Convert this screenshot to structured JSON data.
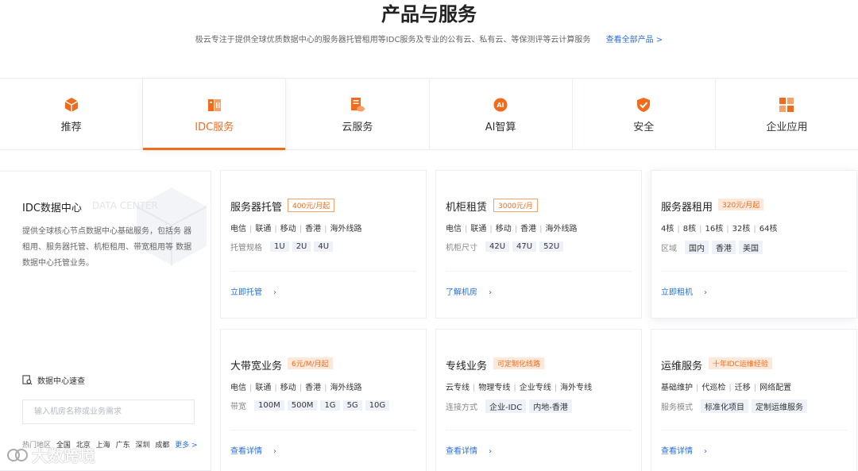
{
  "hero": {
    "title": "产品与服务",
    "subtitle": "极云专注于提供全球优质数据中心的服务器托管租用等IDC服务及专业的公有云、私有云、等保测评等云计算服务",
    "all_link": "查看全部产品 >"
  },
  "tabs": [
    {
      "label": "推荐",
      "icon": "cube-icon",
      "active": false
    },
    {
      "label": "IDC服务",
      "icon": "server-rack-icon",
      "active": true
    },
    {
      "label": "云服务",
      "icon": "cloud-doc-icon",
      "active": false
    },
    {
      "label": "AI智算",
      "icon": "ai-icon",
      "active": false
    },
    {
      "label": "安全",
      "icon": "shield-icon",
      "active": false
    },
    {
      "label": "企业应用",
      "icon": "grid-icon",
      "active": false
    }
  ],
  "left_panel": {
    "title": "IDC数据中心",
    "title_en": "DATA CENTER",
    "description": "提供全球核心节点数据中心基础服务，包括务 器租用、服务器托管、机柜租用、带宽租用等 数据数据中心托管业务。",
    "speed_title": "数据中心速查",
    "search_placeholder": "输入机房名称或业务需求",
    "hot_label": "热门地区",
    "hot_cities": [
      "全国",
      "北京",
      "上海",
      "广东",
      "深圳",
      "成都"
    ],
    "more": "更多 >"
  },
  "cards": [
    {
      "title": "服务器托管",
      "badge": "400元/月起",
      "badge_style": "outline",
      "lines": [
        "电信",
        "联通",
        "移动",
        "香港",
        "海外线路"
      ],
      "spec_label": "托管规格",
      "chips": [
        "1U",
        "2U",
        "4U"
      ],
      "action": "立即托管"
    },
    {
      "title": "机柜租赁",
      "badge": "3000元/月",
      "badge_style": "outline",
      "lines": [
        "电信",
        "联通",
        "移动",
        "香港",
        "海外线路"
      ],
      "spec_label": "机柜尺寸",
      "chips": [
        "42U",
        "47U",
        "52U"
      ],
      "action": "了解机房"
    },
    {
      "title": "服务器租用",
      "badge": "320元/月起",
      "badge_style": "filled",
      "lines": [
        "4核",
        "8核",
        "16核",
        "32核",
        "64核"
      ],
      "spec_label": "区域",
      "chips": [
        "国内",
        "香港",
        "美国"
      ],
      "action": "立即租机"
    },
    {
      "title": "大带宽业务",
      "badge": "6元/M/月起",
      "badge_style": "filled",
      "lines": [
        "电信",
        "联通",
        "移动",
        "香港",
        "海外线路"
      ],
      "spec_label": "带宽",
      "chips": [
        "100M",
        "500M",
        "1G",
        "5G",
        "10G"
      ],
      "action": "查看详情"
    },
    {
      "title": "专线业务",
      "badge": "可定制化线路",
      "badge_style": "filled",
      "lines": [
        "云专线",
        "物理专线",
        "企业专线",
        "海外专线"
      ],
      "spec_label": "连接方式",
      "chips": [
        "企业-IDC",
        "内地-香港"
      ],
      "action": "查看详情"
    },
    {
      "title": "运维服务",
      "badge": "十年IDC运维经验",
      "badge_style": "filled",
      "lines": [
        "基础维护",
        "代巡检",
        "迁移",
        "网络配置"
      ],
      "spec_label": "服务模式",
      "chips": [
        "标准化项目",
        "定制运维服务"
      ],
      "action": "查看详情"
    }
  ],
  "watermark": "大数跨境",
  "colors": {
    "accent": "#f26b1d",
    "link": "#2a6fdb",
    "border": "#eceef2"
  }
}
